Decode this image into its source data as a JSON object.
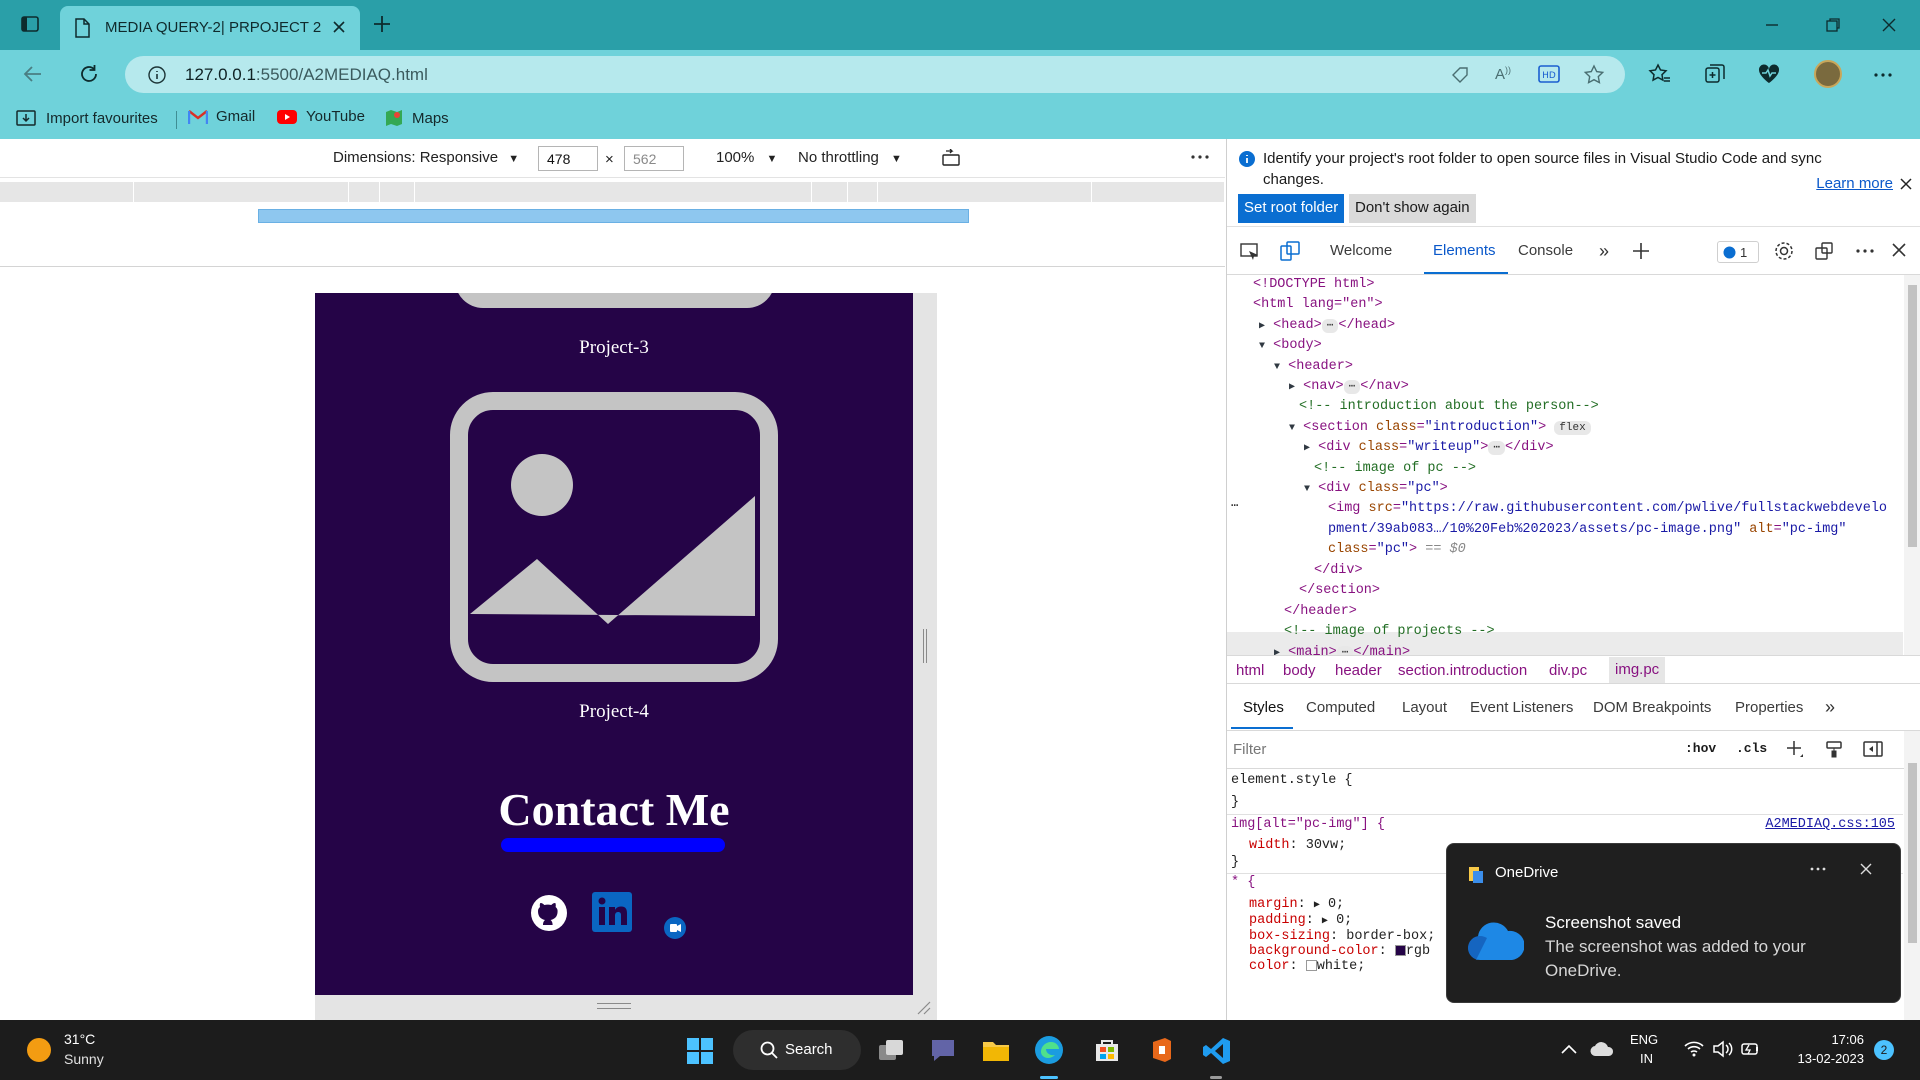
{
  "browser": {
    "tab_title": "MEDIA QUERY-2| PRPOJECT 2",
    "url_host": "127.0.0.1",
    "url_path": ":5500/A2MEDIAQ.html",
    "favourites": [
      "Import favourites",
      "Gmail",
      "YouTube",
      "Maps"
    ]
  },
  "device_toolbar": {
    "dimensions_label": "Dimensions: Responsive",
    "width": "478",
    "height": "562",
    "times": "×",
    "zoom": "100%",
    "throttling": "No throttling"
  },
  "emulated_page": {
    "project3_label": "Project-3",
    "project4_label": "Project-4",
    "contact_heading": "Contact Me",
    "colors": {
      "background": "#250447",
      "underline": "#0000ff"
    }
  },
  "devtools": {
    "banner": {
      "message": "Identify your project's root folder to open source files in Visual Studio Code and sync changes.",
      "primary_button": "Set root folder",
      "secondary_button": "Don't show again",
      "learn_more": "Learn more"
    },
    "tabs": [
      "Welcome",
      "Elements",
      "Console"
    ],
    "issues_count": "1",
    "dom": {
      "doctype": "<!DOCTYPE html>",
      "html_open": "<html lang=\"en\">",
      "head": "<head>",
      "head_close": "</head>",
      "body": "<body>",
      "header": "<header>",
      "nav": "<nav>",
      "nav_close": "</nav>",
      "comment_intro": "<!-- introduction about the person-->",
      "section_open_tag": "<section",
      "section_attr": "class",
      "section_val": "\"introduction\"",
      "flex_badge": "flex",
      "writeup_tag": "<div",
      "writeup_val": "\"writeup\"",
      "div_close": "</div>",
      "comment_pc": "<!-- image of pc -->",
      "pc_val": "\"pc\"",
      "img_tag": "<img",
      "img_src_line1": "\"https://raw.githubusercontent.com/pwlive/fullstackwebdevelo",
      "img_src_line2": "pment/39ab083…/10%20Feb%202023/assets/pc-image.png\"",
      "img_alt_val": "\"pc-img\"",
      "img_class_val": "\"pc\"",
      "img_dollar": "== $0",
      "section_close": "</section>",
      "header_close": "</header>",
      "comment_projects": "<!-- image of projects -->",
      "main": "<main>",
      "main_close": "</main>"
    },
    "breadcrumbs": [
      "html",
      "body",
      "header",
      "section.introduction",
      "div.pc",
      "img.pc"
    ],
    "style_tabs": [
      "Styles",
      "Computed",
      "Layout",
      "Event Listeners",
      "DOM Breakpoints",
      "Properties"
    ],
    "filter_placeholder": "Filter",
    "hov": ":hov",
    "cls": ".cls",
    "styles": {
      "element_style": "element.style {",
      "close_brace": "}",
      "rule1_selector": "img[alt=\"pc-img\"] {",
      "rule1_source": "A2MEDIAQ.css:105",
      "rule1_prop": "width",
      "rule1_val": "30vw;",
      "rule2_selector": "* {",
      "margin_prop": "margin",
      "margin_val": "0;",
      "padding_prop": "padding",
      "padding_val": "0;",
      "boxsizing_prop": "box-sizing",
      "boxsizing_val": "border-box;",
      "bg_prop": "background-color",
      "bg_val": "rgb",
      "color_prop": "color",
      "color_val": "white;"
    }
  },
  "toast": {
    "app": "OneDrive",
    "title": "Screenshot saved",
    "body": "The screenshot was added to your OneDrive."
  },
  "taskbar": {
    "temperature": "31°C",
    "weather": "Sunny",
    "search": "Search",
    "lang1": "ENG",
    "lang2": "IN",
    "time": "17:06",
    "date": "13-02-2023",
    "notification_count": "2"
  }
}
